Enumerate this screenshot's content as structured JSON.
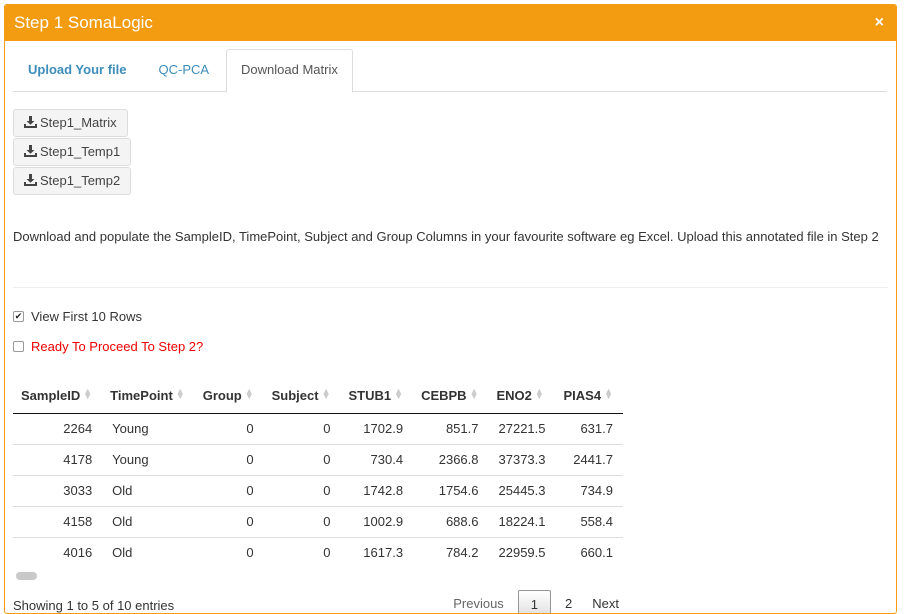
{
  "window": {
    "title": "Step 1 SomaLogic",
    "close_label": "×"
  },
  "tabs": [
    {
      "label": "Upload Your file"
    },
    {
      "label": "QC-PCA"
    },
    {
      "label": "Download Matrix"
    }
  ],
  "buttons": [
    {
      "label": "Step1_Matrix",
      "icon": "download-icon"
    },
    {
      "label": "Step1_Temp1",
      "icon": "download-icon"
    },
    {
      "label": "Step1_Temp2",
      "icon": "download-icon"
    }
  ],
  "info_text": "Download and populate the SampleID, TimePoint, Subject and Group Columns in your favourite software eg Excel. Upload this annotated file in Step 2",
  "checkboxes": {
    "view_first": {
      "label": "View First 10 Rows",
      "checked": true
    },
    "ready": {
      "label": "Ready To Proceed To Step 2?",
      "checked": false
    }
  },
  "table": {
    "columns": [
      "SampleID",
      "TimePoint",
      "Group",
      "Subject",
      "STUB1",
      "CEBPB",
      "ENO2",
      "PIAS4"
    ],
    "rows": [
      [
        "2264",
        "Young",
        "0",
        "0",
        "1702.9",
        "851.7",
        "27221.5",
        "631.7"
      ],
      [
        "4178",
        "Young",
        "0",
        "0",
        "730.4",
        "2366.8",
        "37373.3",
        "2441.7"
      ],
      [
        "3033",
        "Old",
        "0",
        "0",
        "1742.8",
        "1754.6",
        "25445.3",
        "734.9"
      ],
      [
        "4158",
        "Old",
        "0",
        "0",
        "1002.9",
        "688.6",
        "18224.1",
        "558.4"
      ],
      [
        "4016",
        "Old",
        "0",
        "0",
        "1617.3",
        "784.2",
        "22959.5",
        "660.1"
      ]
    ]
  },
  "footer": {
    "showing": "Showing 1 to 5 of 10 entries",
    "previous": "Previous",
    "pages": [
      "1",
      "2"
    ],
    "next": "Next"
  },
  "colors": {
    "header": "#f39c12",
    "tab_link": "#3c8dbc",
    "warning_text": "#ee0000"
  }
}
